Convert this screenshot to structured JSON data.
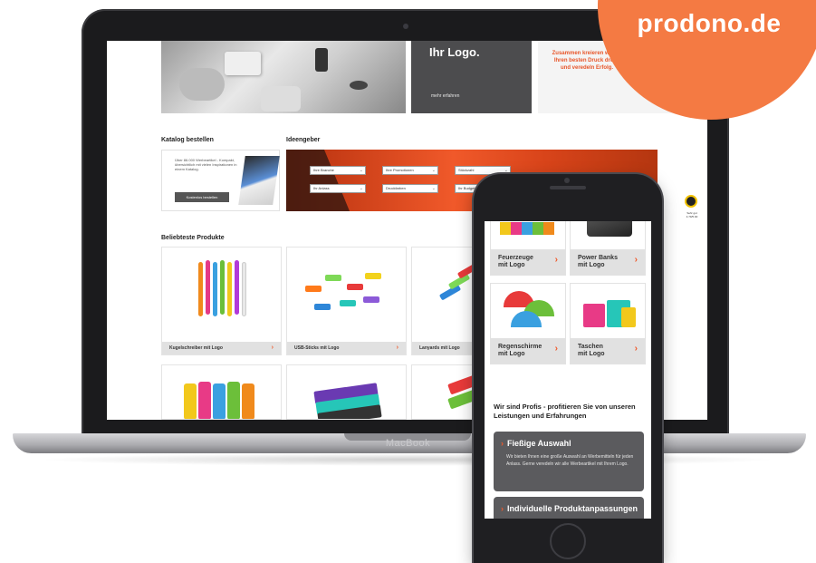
{
  "brand": {
    "domain": "prodono.de",
    "color": "#f47a43"
  },
  "laptop": {
    "brand_label": "MacBook"
  },
  "website": {
    "hero": {
      "dark_title": "Ihr Logo.",
      "dark_link": "mehr erfahren",
      "white_text": "Zusammen kreieren wir für Ihren besten Druck druck und veredeln Erfolg."
    },
    "catalog": {
      "title": "Katalog bestellen",
      "text": "Über 86.000 Werbeartikel - Kompakt, übersichtlich mit vielen Inspirationen in einem Katalog.",
      "button": "Kostenlos bestellen"
    },
    "ideen": {
      "title": "Ideengeber",
      "selects": [
        "Ihre Branche",
        "Ihre Promotionen",
        "Stückzahl",
        "Ihr Anlass",
        "Druckfarben",
        "Ihr Budget"
      ]
    },
    "products": {
      "title": "Beliebteste Produkte",
      "items": [
        {
          "label": "Kugelschreiber mit Logo"
        },
        {
          "label": "USB-Sticks mit Logo"
        },
        {
          "label": "Lanyards mit Logo"
        }
      ]
    },
    "trusted": {
      "text": "Sehr gut 4.79/5.00"
    }
  },
  "phone": {
    "cards": [
      {
        "line1": "Feuerzeuge",
        "line2": "mit Logo"
      },
      {
        "line1": "Power Banks",
        "line2": "mit Logo"
      },
      {
        "line1": "Regenschirme",
        "line2": "mit Logo"
      },
      {
        "line1": "Taschen",
        "line2": "mit Logo"
      }
    ],
    "profis_title": "Wir sind Profis - profitieren Sie von unseren Leistungen und Erfahrungen",
    "boxes": [
      {
        "title": "Fießige Auswahl",
        "text": "Wir bieten Ihnen eine große Auswahl an Werbemitteln für jeden Anlass. Gerne veredeln wir alle Werbeartikel mit Ihrem Logo."
      },
      {
        "title": "Individuelle Produktanpassungen",
        "text": ""
      }
    ]
  }
}
